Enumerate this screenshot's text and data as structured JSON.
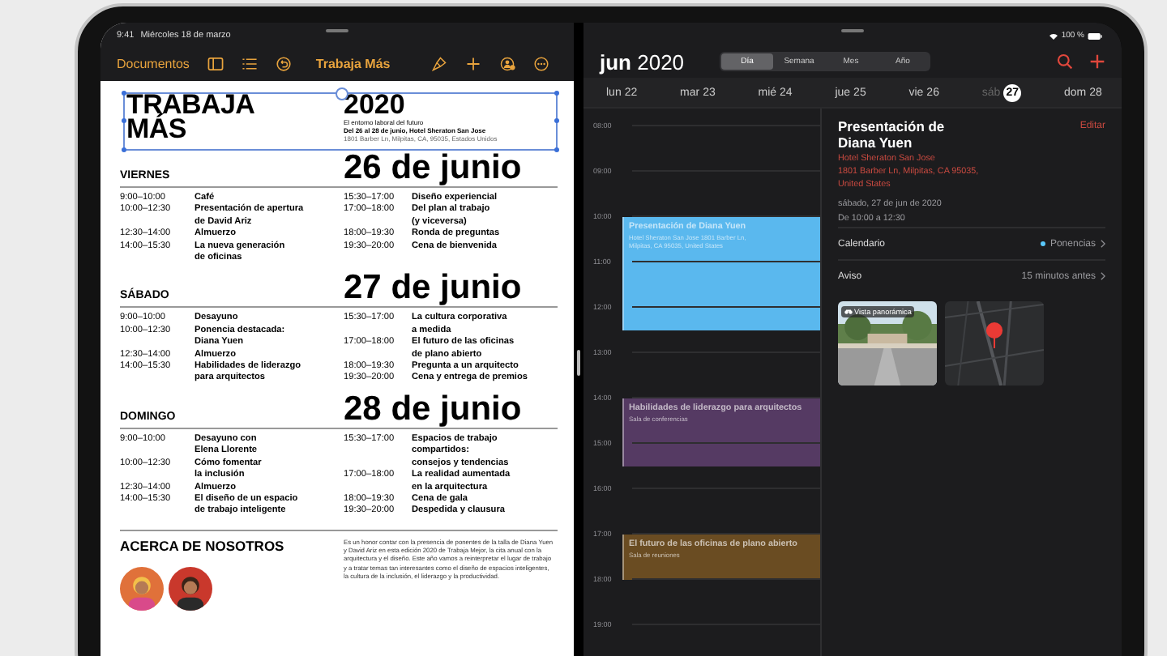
{
  "pages": {
    "status_bar": {
      "time": "9:41",
      "date": "Miércoles 18 de marzo"
    },
    "toolbar": {
      "back": "Documentos",
      "title": "Trabaja Más"
    },
    "document": {
      "title": "TRABAJA\nMÁS",
      "year": "2020",
      "subtitle": "El entorno laboral del futuro",
      "dates": "Del 26 al 28 de junio, Hotel Sheraton San Jose",
      "address": "1801 Barber Ln, Milpitas, CA, 95035, Estados Unidos",
      "selected": true,
      "days": [
        {
          "name": "VIERNES",
          "date": "26 de junio",
          "left": [
            {
              "time": "9:00–10:00",
              "title": "Café"
            },
            {
              "time": "10:00–12:30",
              "title": "Presentación de apertura\nde David Ariz"
            },
            {
              "time": "12:30–14:00",
              "title": "Almuerzo"
            },
            {
              "time": "14:00–15:30",
              "title": "La nueva generación\nde oficinas"
            }
          ],
          "right": [
            {
              "time": "15:30–17:00",
              "title": "Diseño experiencial"
            },
            {
              "time": "17:00–18:00",
              "title": "Del plan al trabajo\n(y viceversa)"
            },
            {
              "time": "18:00–19:30",
              "title": "Ronda de preguntas"
            },
            {
              "time": "19:30–20:00",
              "title": "Cena de bienvenida"
            }
          ]
        },
        {
          "name": "SÁBADO",
          "date": "27 de junio",
          "left": [
            {
              "time": "9:00–10:00",
              "title": "Desayuno"
            },
            {
              "time": "10:00–12:30",
              "title": "Ponencia destacada:\nDiana Yuen"
            },
            {
              "time": "12:30–14:00",
              "title": "Almuerzo"
            },
            {
              "time": "14:00–15:30",
              "title": "Habilidades de liderazgo\npara arquitectos"
            }
          ],
          "right": [
            {
              "time": "15:30–17:00",
              "title": "La cultura corporativa\na medida"
            },
            {
              "time": "17:00–18:00",
              "title": "El futuro de las oficinas\nde plano abierto"
            },
            {
              "time": "18:00–19:30",
              "title": "Pregunta a un arquitecto"
            },
            {
              "time": "19:30–20:00",
              "title": "Cena y entrega de premios"
            }
          ]
        },
        {
          "name": "DOMINGO",
          "date": "28 de junio",
          "left": [
            {
              "time": "9:00–10:00",
              "title": "Desayuno con\nElena Llorente"
            },
            {
              "time": "10:00–12:30",
              "title": "Cómo fomentar\nla inclusión"
            },
            {
              "time": "12:30–14:00",
              "title": "Almuerzo"
            },
            {
              "time": "14:00–15:30",
              "title": "El diseño de un espacio\nde trabajo inteligente"
            }
          ],
          "right": [
            {
              "time": "15:30–17:00",
              "title": "Espacios de trabajo\ncompartidos:\nconsejos y tendencias"
            },
            {
              "time": "17:00–18:00",
              "title": "La realidad aumentada\nen la arquitectura"
            },
            {
              "time": "18:00–19:30",
              "title": "Cena de gala"
            },
            {
              "time": "19:30–20:00",
              "title": "Despedida y clausura"
            }
          ]
        }
      ],
      "about": {
        "heading": "ACERCA DE NOSOTROS",
        "text": "Es un honor contar con la presencia de ponentes de la talla de Diana Yuen y David Ariz en esta edición 2020 de Trabaja Mejor, la cita anual con la arquitectura y el diseño. Este año vamos a reinterpretar el lugar de trabajo y a tratar temas tan interesantes como el diseño de espacios inteligentes, la cultura de la inclusión, el liderazgo y la productividad."
      }
    }
  },
  "calendar": {
    "battery": "100 %",
    "month": "jun",
    "year": "2020",
    "views": [
      {
        "label": "Día",
        "selected": true
      },
      {
        "label": "Semana",
        "selected": false
      },
      {
        "label": "Mes",
        "selected": false
      },
      {
        "label": "Año",
        "selected": false
      }
    ],
    "days": [
      {
        "name": "lun",
        "number": "22",
        "selected": false
      },
      {
        "name": "mar",
        "number": "23",
        "selected": false
      },
      {
        "name": "mié",
        "number": "24",
        "selected": false
      },
      {
        "name": "jue",
        "number": "25",
        "selected": false
      },
      {
        "name": "vie",
        "number": "26",
        "selected": false
      },
      {
        "name": "sáb",
        "number": "27",
        "selected": true
      },
      {
        "name": "dom",
        "number": "28",
        "selected": false
      }
    ],
    "hours": [
      {
        "label": "08:00"
      },
      {
        "label": "09:00"
      },
      {
        "label": "10:00",
        "event": {
          "title": "Presentación de Diana Yuen",
          "subtitle": "Hotel Sheraton San Jose 1801 Barber Ln,\nMilpitas, CA  95035, United States",
          "color": "#5ab8ee"
        }
      },
      {
        "label": "11:00"
      },
      {
        "label": "12:00"
      },
      {
        "label": "13:00"
      },
      {
        "label": "14:00",
        "event": {
          "title": "Habilidades de liderazgo para arquitectos",
          "subtitle": "Sala de conferencias",
          "color": "#553a63"
        }
      },
      {
        "label": "15:00"
      },
      {
        "label": "16:00"
      },
      {
        "label": "17:00",
        "event": {
          "title": "El futuro de las oficinas de plano abierto",
          "subtitle": "Sala de reuniones",
          "color": "#6a4c22"
        }
      },
      {
        "label": "18:00"
      },
      {
        "label": "19:00"
      }
    ],
    "detail": {
      "title": "Presentación de\nDiana Yuen",
      "edit": "Editar",
      "location": "Hotel Sheraton San Jose\n1801 Barber Ln, Milpitas, CA  95035,\nUnited States",
      "date": "sábado, 27 de jun de 2020",
      "time": "De 10:00 a 12:30",
      "rows": [
        {
          "label": "Calendario",
          "value": "Ponencias",
          "color": "#5ac8fa"
        },
        {
          "label": "Aviso",
          "value": "15 minutos antes"
        }
      ],
      "street_view": {
        "label": "Vista panorámica"
      }
    }
  }
}
